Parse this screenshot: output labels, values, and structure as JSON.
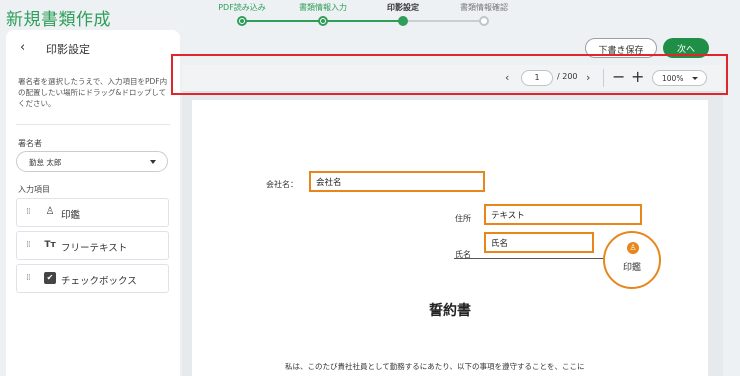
{
  "app": {
    "title": "新規書類作成"
  },
  "steps": [
    {
      "label": "PDF読み込み"
    },
    {
      "label": "書類情報入力"
    },
    {
      "label": "印影設定"
    },
    {
      "label": "書類情報確認"
    }
  ],
  "sidebar": {
    "back_icon": "chevron-left-icon",
    "title": "印影設定",
    "description": "署名者を選択したうえで、入力項目をPDF内の配置したい場所にドラッグ&ドロップしてください。",
    "signer_label": "署名者",
    "signer_value": "勤怠 太郎",
    "items_label": "入力項目",
    "items": [
      {
        "label": "印鑑",
        "icon": "stamp-icon"
      },
      {
        "label": "フリーテキスト",
        "icon": "text-format-icon"
      },
      {
        "label": "チェックボックス",
        "icon": "checkbox-icon"
      }
    ]
  },
  "actions": {
    "draft": "下書き保存",
    "next": "次へ"
  },
  "viewer": {
    "page": "1",
    "total": "/ 200",
    "zoom": "100%",
    "highlight_color": "#e0262b"
  },
  "document": {
    "company_label": "会社名：",
    "company_field": "会社名",
    "address_label": "住所",
    "address_field": "テキスト",
    "name_label": "氏名",
    "name_field": "氏名",
    "stamp_label": "印鑑",
    "title": "誓約書",
    "body": "私は、このたび貴社社員として勤務するにあたり、以下の事項を遵守することを、ここに",
    "field_color": "#e8861c"
  },
  "colors": {
    "accent": "#2e9e58",
    "primary_button": "#1f8f48"
  }
}
